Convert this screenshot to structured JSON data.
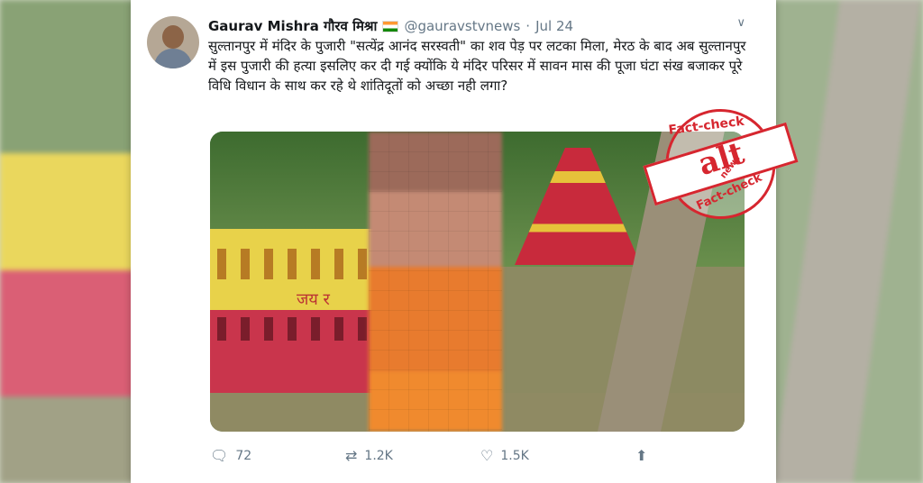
{
  "tweet": {
    "author_name": "Gaurav Mishra गौरव मिश्रा",
    "handle": "@gauravstvnews",
    "separator": "·",
    "date": "Jul 24",
    "text": "सुल्तानपुर में मंदिर के पुजारी \"सत्येंद्र आनंद सरस्वती\" का शव पेड़ पर लटका मिला, मेरठ के बाद अब सुल्तानपुर में इस पुजारी की हत्या इसलिए कर दी गई क्योंकि ये मंदिर परिसर में सावन मास की पूजा घंटा संख बजाकर पूरे विधि विधान के साथ कर रहे थे शांतिदूतों को अच्छा नही लगा?",
    "photo_wall_text": "जय र",
    "replies": "72",
    "retweets": "1.2K",
    "likes": "1.5K"
  },
  "icons": {
    "caret": "chevron-down-icon",
    "reply": "reply-icon",
    "retweet": "retweet-icon",
    "like": "heart-icon",
    "share": "share-icon",
    "flag": "india-flag-icon"
  },
  "stamp": {
    "top_text": "Fact-check",
    "bottom_text": "Fact-check",
    "logo": "alt",
    "logo_sub": "news",
    "color": "#d6262f"
  }
}
